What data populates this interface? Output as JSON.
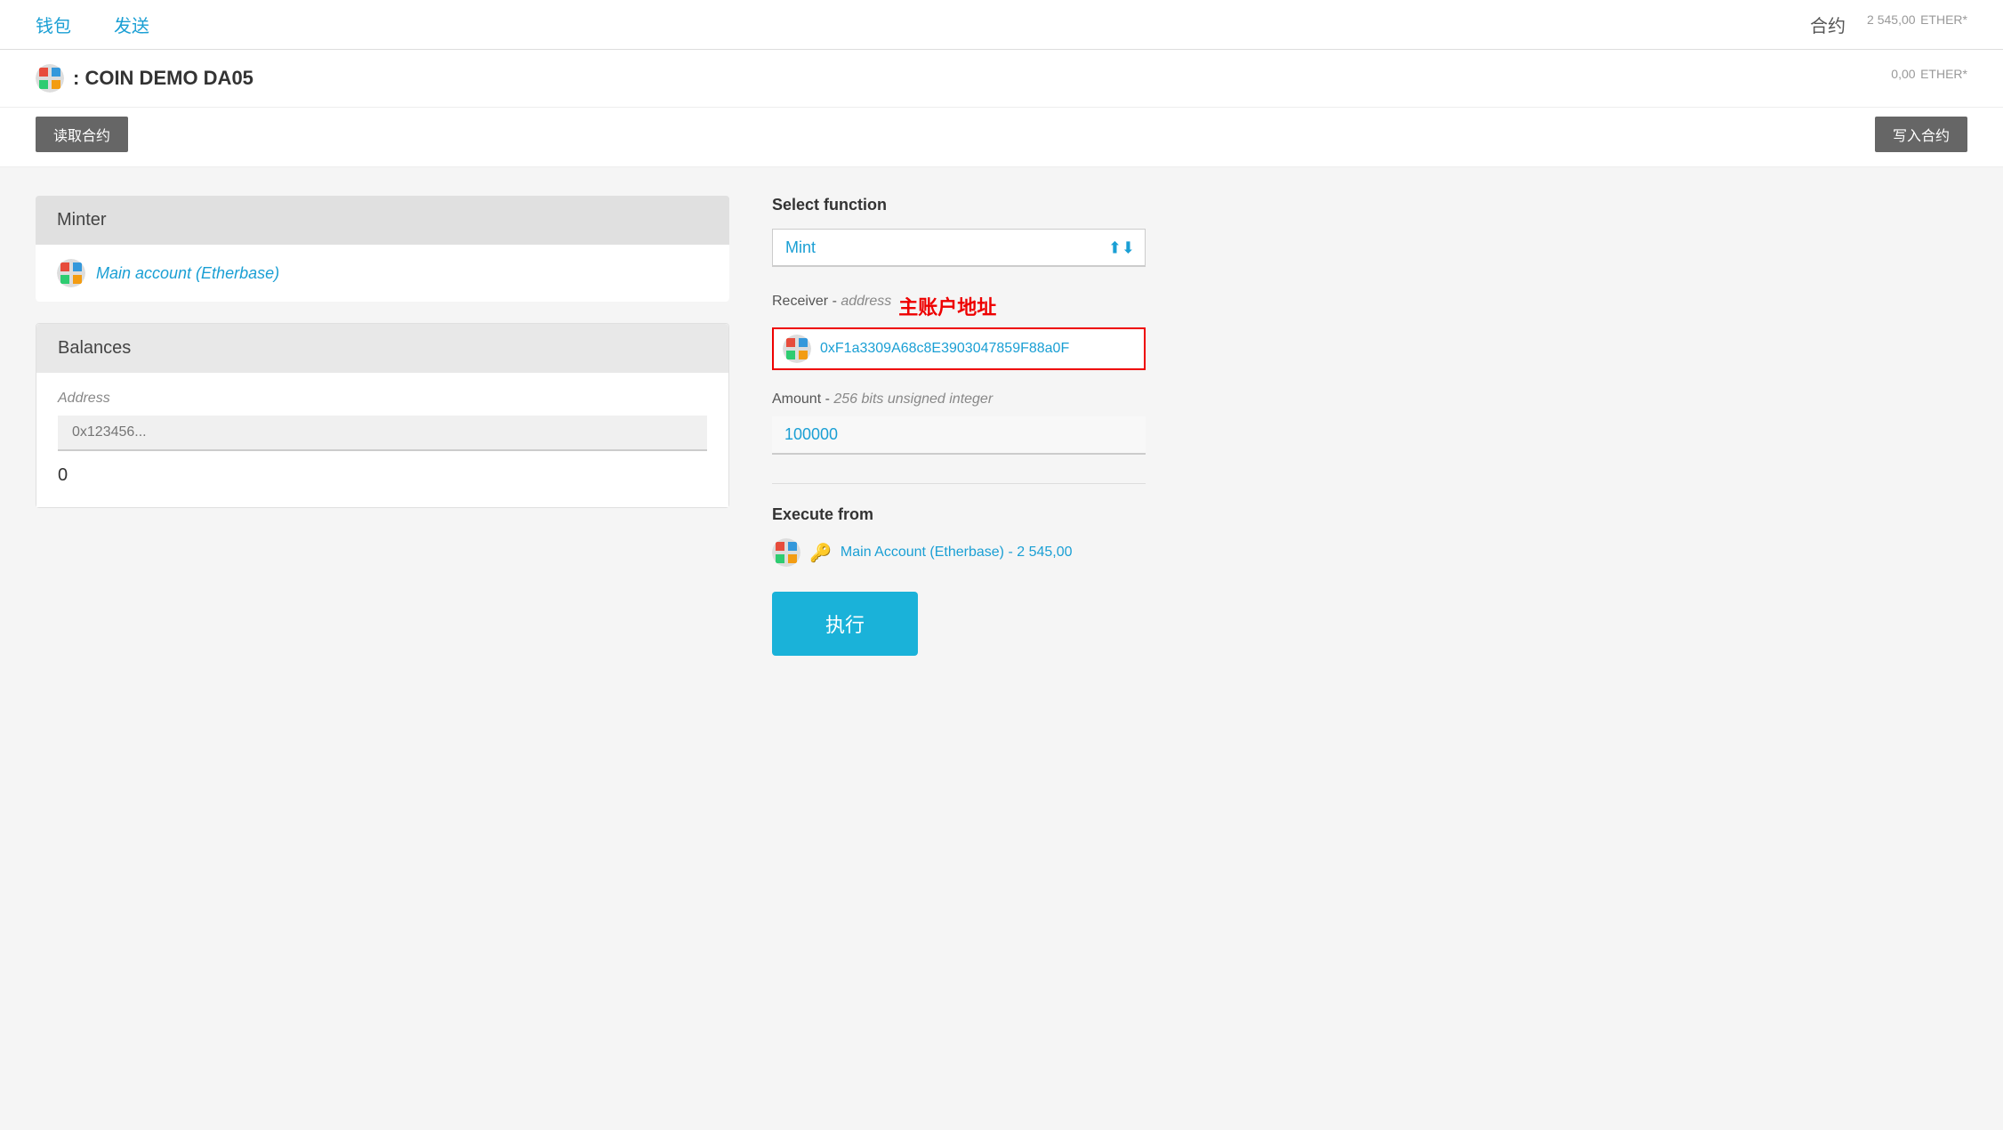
{
  "nav": {
    "wallet_label": "钱包",
    "send_label": "发送",
    "contract_label": "合约",
    "balance": "2 545,00",
    "balance_unit": "ETHER*"
  },
  "contract": {
    "name": ": COIN DEMO DA05",
    "balance": "0,00",
    "balance_unit": "ETHER*",
    "read_button": "读取合约",
    "write_button": "写入合约"
  },
  "left": {
    "minter_title": "Minter",
    "account_name": "Main account (Etherbase)",
    "balances_title": "Balances",
    "address_label": "Address",
    "address_placeholder": "0x123456...",
    "balance_value": "0"
  },
  "right": {
    "select_function_label": "Select function",
    "selected_function": "Mint",
    "receiver_label": "Receiver",
    "receiver_sublabel": "address",
    "receiver_annotation": "主账户地址",
    "receiver_value": "0xF1a3309A68c8E3903047859F88a0F",
    "amount_label": "Amount",
    "amount_sublabel": "256 bits unsigned integer",
    "amount_value": "100000",
    "execute_from_label": "Execute from",
    "execute_from_account": "Main Account (Etherbase) - 2 545,00",
    "execute_button": "执行"
  }
}
